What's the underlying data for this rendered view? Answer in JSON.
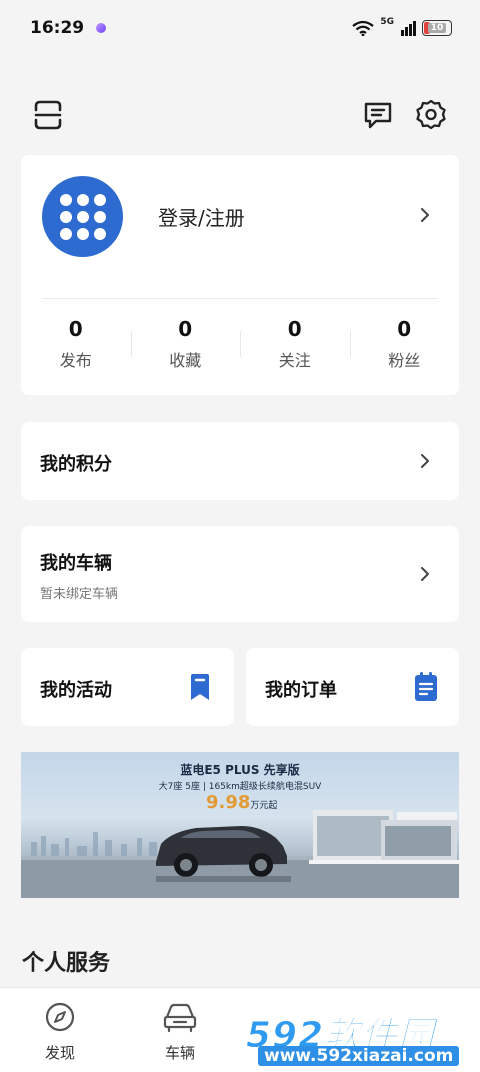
{
  "status_bar": {
    "time": "16:29",
    "network": "5G",
    "battery": "10"
  },
  "profile": {
    "login_label": "登录/注册"
  },
  "stats": [
    {
      "value": "0",
      "label": "发布"
    },
    {
      "value": "0",
      "label": "收藏"
    },
    {
      "value": "0",
      "label": "关注"
    },
    {
      "value": "0",
      "label": "粉丝"
    }
  ],
  "points": {
    "title": "我的积分"
  },
  "vehicle": {
    "title": "我的车辆",
    "subtitle": "暂未绑定车辆"
  },
  "activities": {
    "title": "我的活动"
  },
  "orders": {
    "title": "我的订单"
  },
  "banner": {
    "title": "蓝电E5 PLUS 先享版",
    "subtitle": "大7座 5座 | 165km超级长续航电混SUV",
    "price": "9.98",
    "price_unit": "万元起"
  },
  "section": {
    "title": "个人服务"
  },
  "bottom_nav": [
    {
      "label": "发现",
      "icon": "compass-icon"
    },
    {
      "label": "车辆",
      "icon": "car-icon"
    }
  ],
  "watermark": {
    "brand": "592软件园",
    "url": "www.592xiazai.com"
  },
  "colors": {
    "accent": "#2e6bd1",
    "background": "#f4f4f4",
    "price": "#e49b35"
  }
}
